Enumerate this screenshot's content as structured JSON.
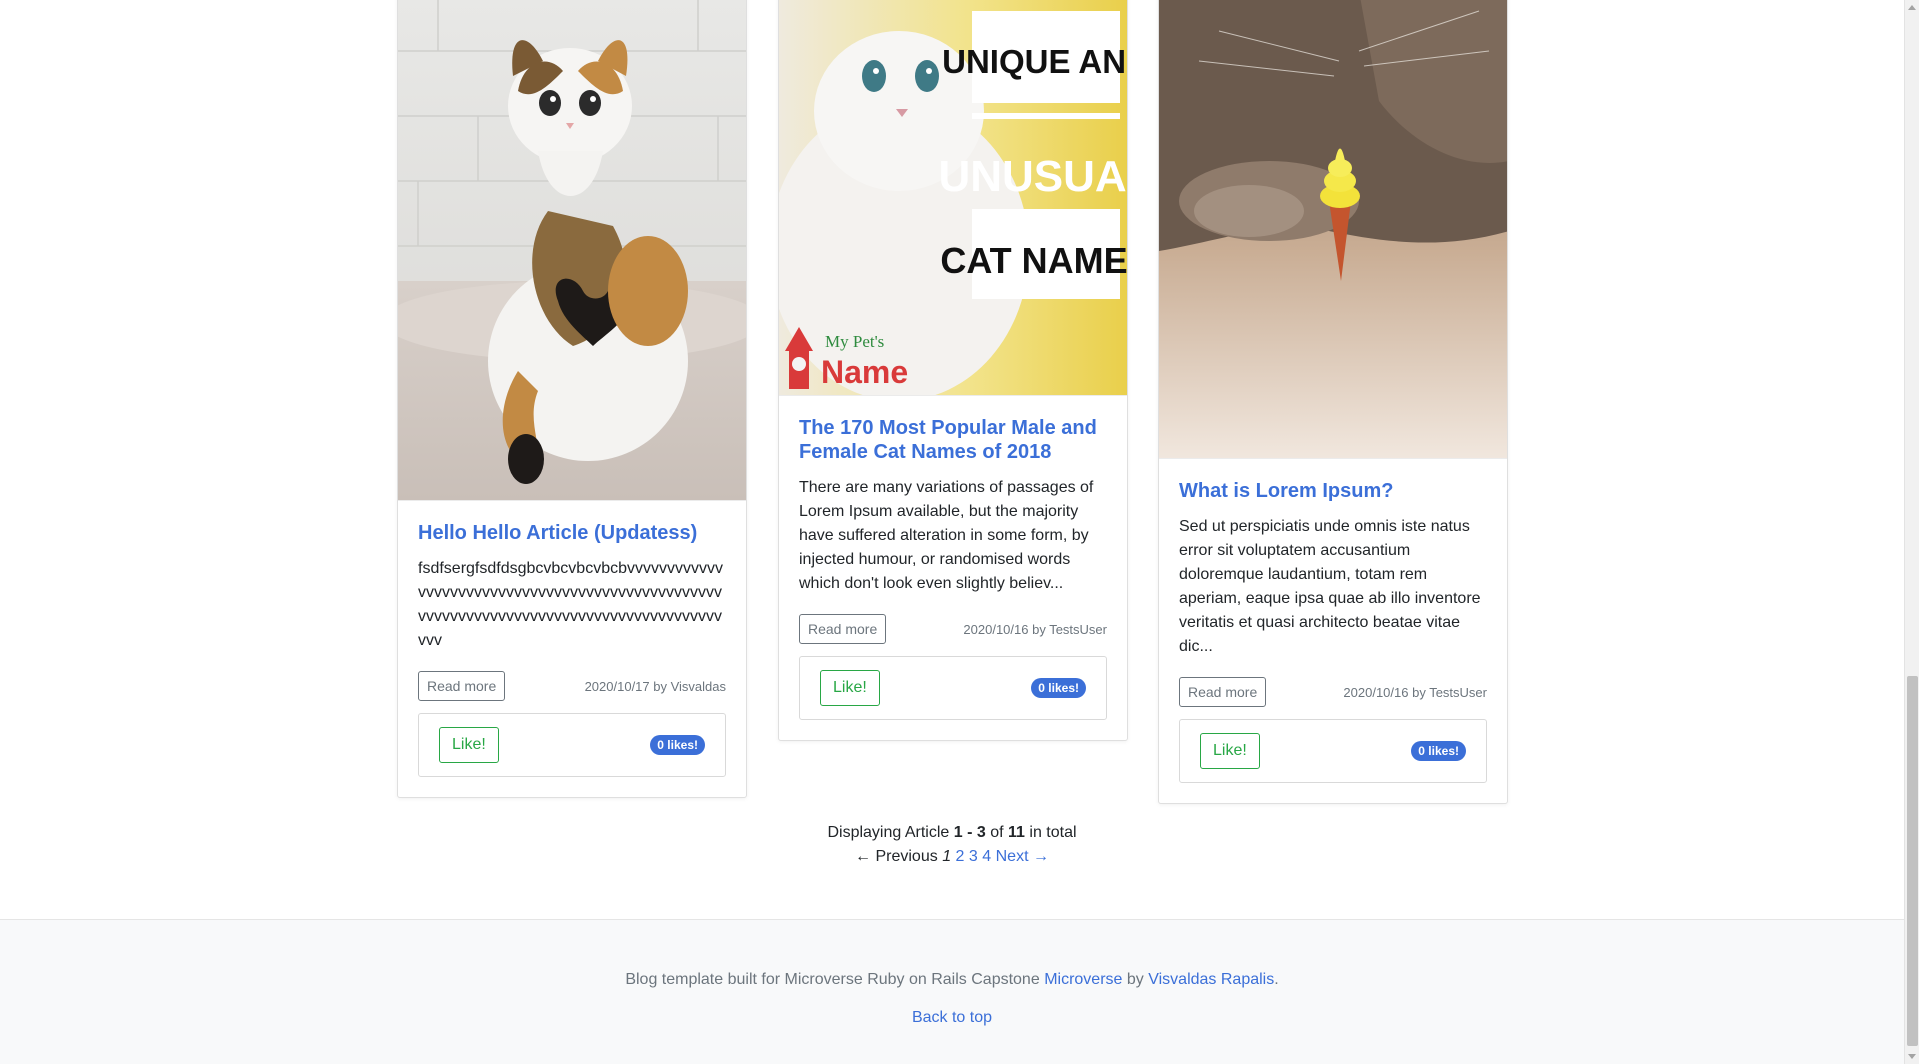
{
  "articles": [
    {
      "image_alt": "calico kitten with heart-shaped spot",
      "title": "Hello Hello Article (Updatess)",
      "excerpt": "fsdfsergfsdfdsgbcvbcvbcvbcbvvvvvvvvvvvvvvvvvvvvvvvvvvvvvvvvvvvvvvvvvvvvvvvvvvvvvvvvvvvvvvvvvvvvvvvvvvvvvvvvvvvvvvvvvvv",
      "read_more": "Read more",
      "meta": "2020/10/17 by Visvaldas",
      "like_label": "Like!",
      "likes": "0 likes!"
    },
    {
      "image_alt": "white persian cat banner",
      "banner_lines": [
        "UNIQUE AND",
        "UNUSUAL",
        "CAT NAMES"
      ],
      "logo_text": [
        "My Pet's",
        "Name"
      ],
      "title": "The 170 Most Popular Male and Female Cat Names of 2018",
      "excerpt": "There are many variations of passages of Lorem Ipsum available, but the majority have suffered alteration in some form, by injected humour, or randomised words which don't look even slightly believ...",
      "read_more": "Read more",
      "meta": "2020/10/16 by TestsUser",
      "like_label": "Like!",
      "likes": "0 likes!"
    },
    {
      "image_alt": "cat sniffing yellow ice cream cone",
      "title": "What is Lorem Ipsum?",
      "excerpt": "Sed ut perspiciatis unde omnis iste natus error sit voluptatem accusantium doloremque laudantium, totam rem aperiam, eaque ipsa quae ab illo inventore veritatis et quasi architecto beatae vitae dic...",
      "read_more": "Read more",
      "meta": "2020/10/16 by TestsUser",
      "like_label": "Like!",
      "likes": "0 likes!"
    }
  ],
  "pagination": {
    "summary_prefix": "Displaying Article",
    "range": "1 - 3",
    "of": "of",
    "total": "11",
    "suffix": "in total",
    "prev": "← Previous",
    "current": "1",
    "pages": [
      "2",
      "3",
      "4"
    ],
    "next": "Next →"
  },
  "footer": {
    "text": "Blog template built for Microverse Ruby on Rails Capstone",
    "link1": "Microverse",
    "by": "by",
    "link2": "Visvaldas Rapalis",
    "period": ".",
    "back_to_top": "Back to top"
  },
  "colors": {
    "link": "#3b6fd8",
    "like": "#28a745",
    "badge": "#3b6fd8",
    "footer_bg": "#f8f9fa"
  }
}
